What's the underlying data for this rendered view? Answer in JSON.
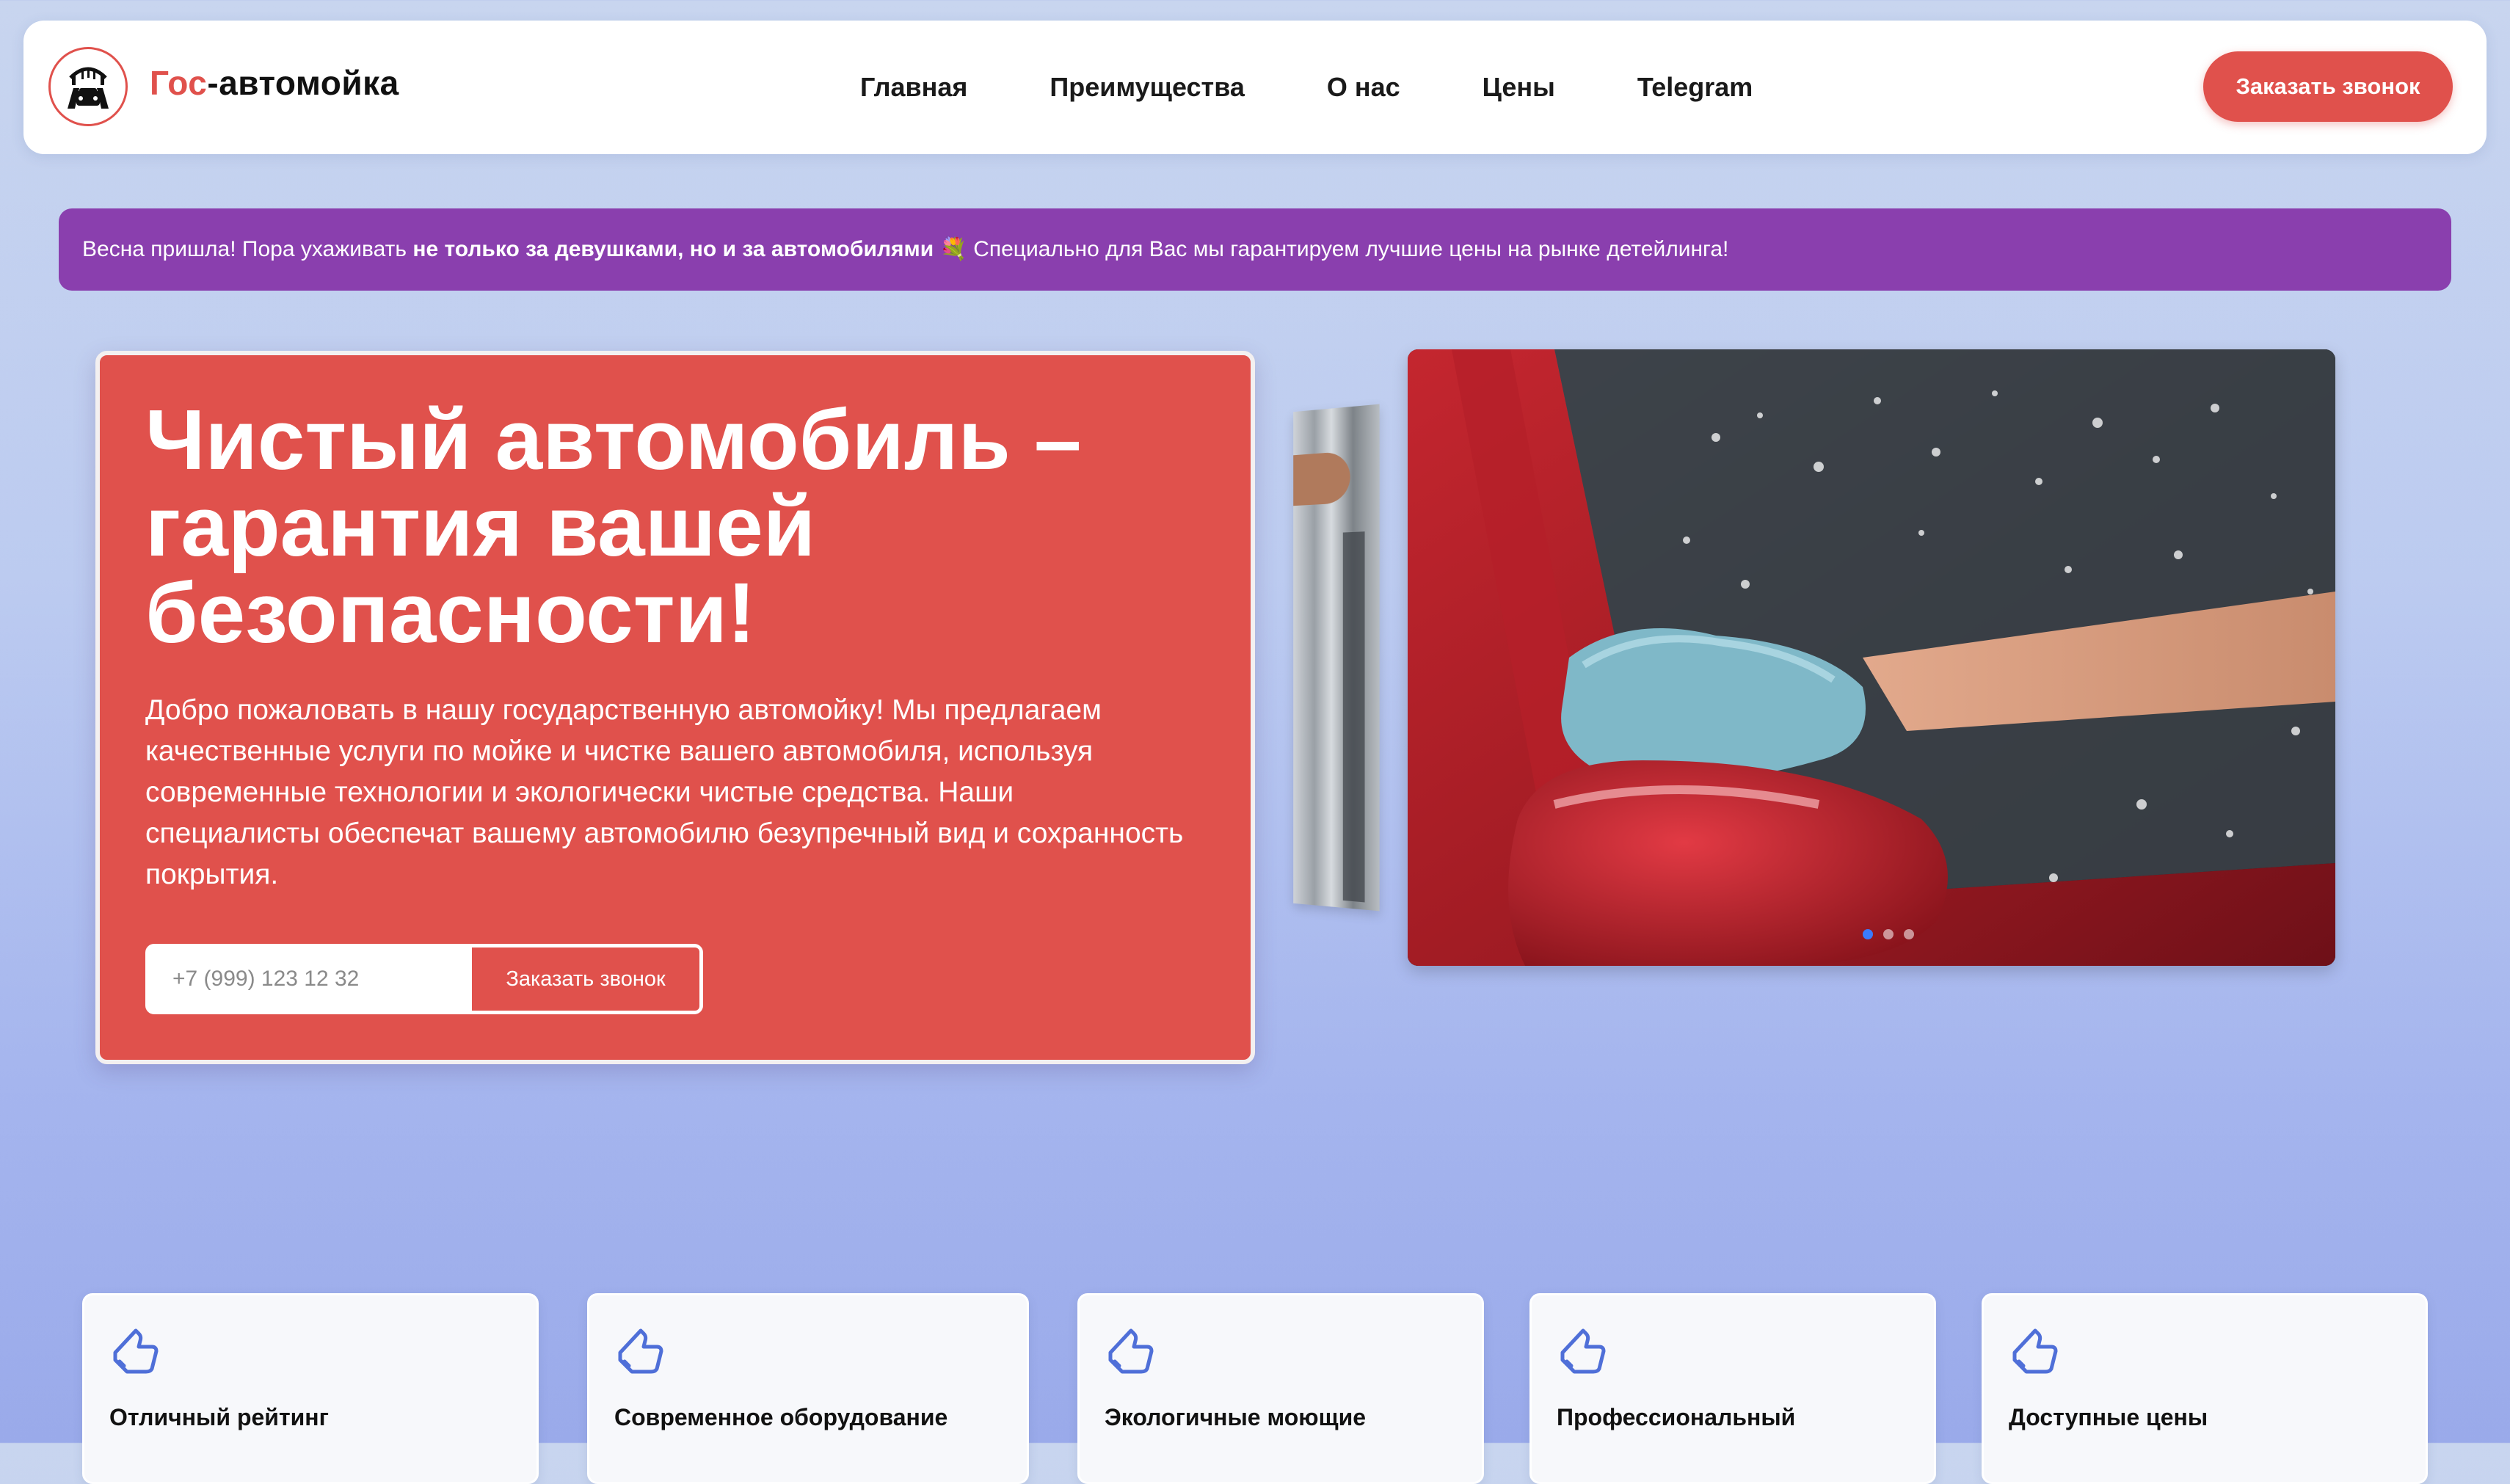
{
  "header": {
    "logo_prefix": "Гос",
    "logo_suffix": "-автомойка",
    "nav": [
      "Главная",
      "Преимущества",
      "О нас",
      "Цены",
      "Telegram"
    ],
    "cta_label": "Заказать звонок"
  },
  "banner": {
    "text_before": "Весна пришла! Пора ухаживать ",
    "text_bold": "не только за девушками, но и за автомобилями",
    "emoji": "💐",
    "text_after": " Специально для Вас мы гарантируем лучшие цены на рынке детейлинга!"
  },
  "hero": {
    "title": "Чистый автомобиль – гарантия вашей безопасности!",
    "description": "Добро пожаловать в нашу государственную автомойку! Мы предлагаем качественные услуги по мойке и чистке вашего автомобиля, используя современные технологии и экологически чистые средства. Наши специалисты обеспечат вашему автомобилю безупречный вид и сохранность покрытия.",
    "phone_placeholder": "+7 (999) 123 12 32",
    "button_label": "Заказать звонок"
  },
  "slider": {
    "active_index": 0,
    "count": 3
  },
  "features": [
    {
      "title": "Отличный рейтинг",
      "icon": "thumbs-up-icon"
    },
    {
      "title": "Современное оборудование",
      "icon": "thumbs-up-icon"
    },
    {
      "title": "Экологичные моющие",
      "icon": "thumbs-up-icon"
    },
    {
      "title": "Профессиональный",
      "icon": "thumbs-up-icon"
    },
    {
      "title": "Доступные цены",
      "icon": "thumbs-up-icon"
    }
  ],
  "colors": {
    "accent": "#e0514c",
    "banner": "#8a3fae",
    "icon": "#4f6fd8"
  }
}
